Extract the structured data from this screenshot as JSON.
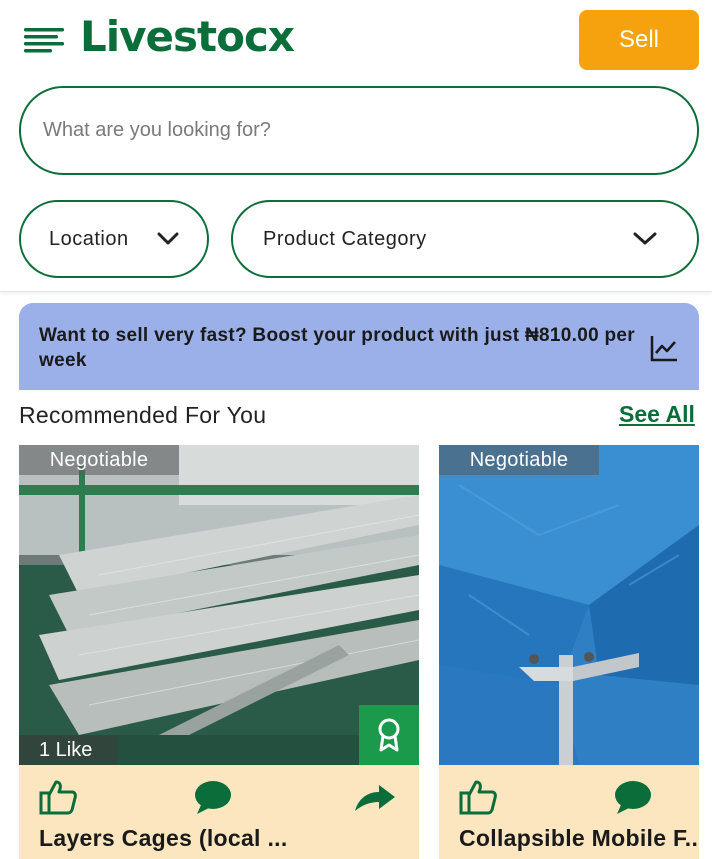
{
  "app": {
    "logo": "Livestocx",
    "sell_label": "Sell"
  },
  "search": {
    "placeholder": "What are you looking for?",
    "value": ""
  },
  "filters": {
    "location_label": "Location",
    "category_label": "Product Category"
  },
  "promo": {
    "text": "Want to sell very fast? Boost your product with just ₦810.00 per week"
  },
  "recommended": {
    "title": "Recommended For You",
    "see_all": "See All",
    "items": [
      {
        "badge": "Negotiable",
        "likes": "1 Like",
        "title": "Layers Cages (local ..."
      },
      {
        "badge": "Negotiable",
        "title": "Collapsible Mobile F..."
      }
    ]
  },
  "colors": {
    "brand_green": "#0b6e3a",
    "sell_orange": "#f5a20e",
    "promo_blue": "#9bb0e8",
    "card_footer": "#fbe6bf",
    "award_green": "#1a9a4a"
  },
  "icons": [
    "menu-icon",
    "chevron-down-icon",
    "trend-chart-icon",
    "award-icon",
    "thumbs-up-icon",
    "comment-icon",
    "share-icon"
  ]
}
